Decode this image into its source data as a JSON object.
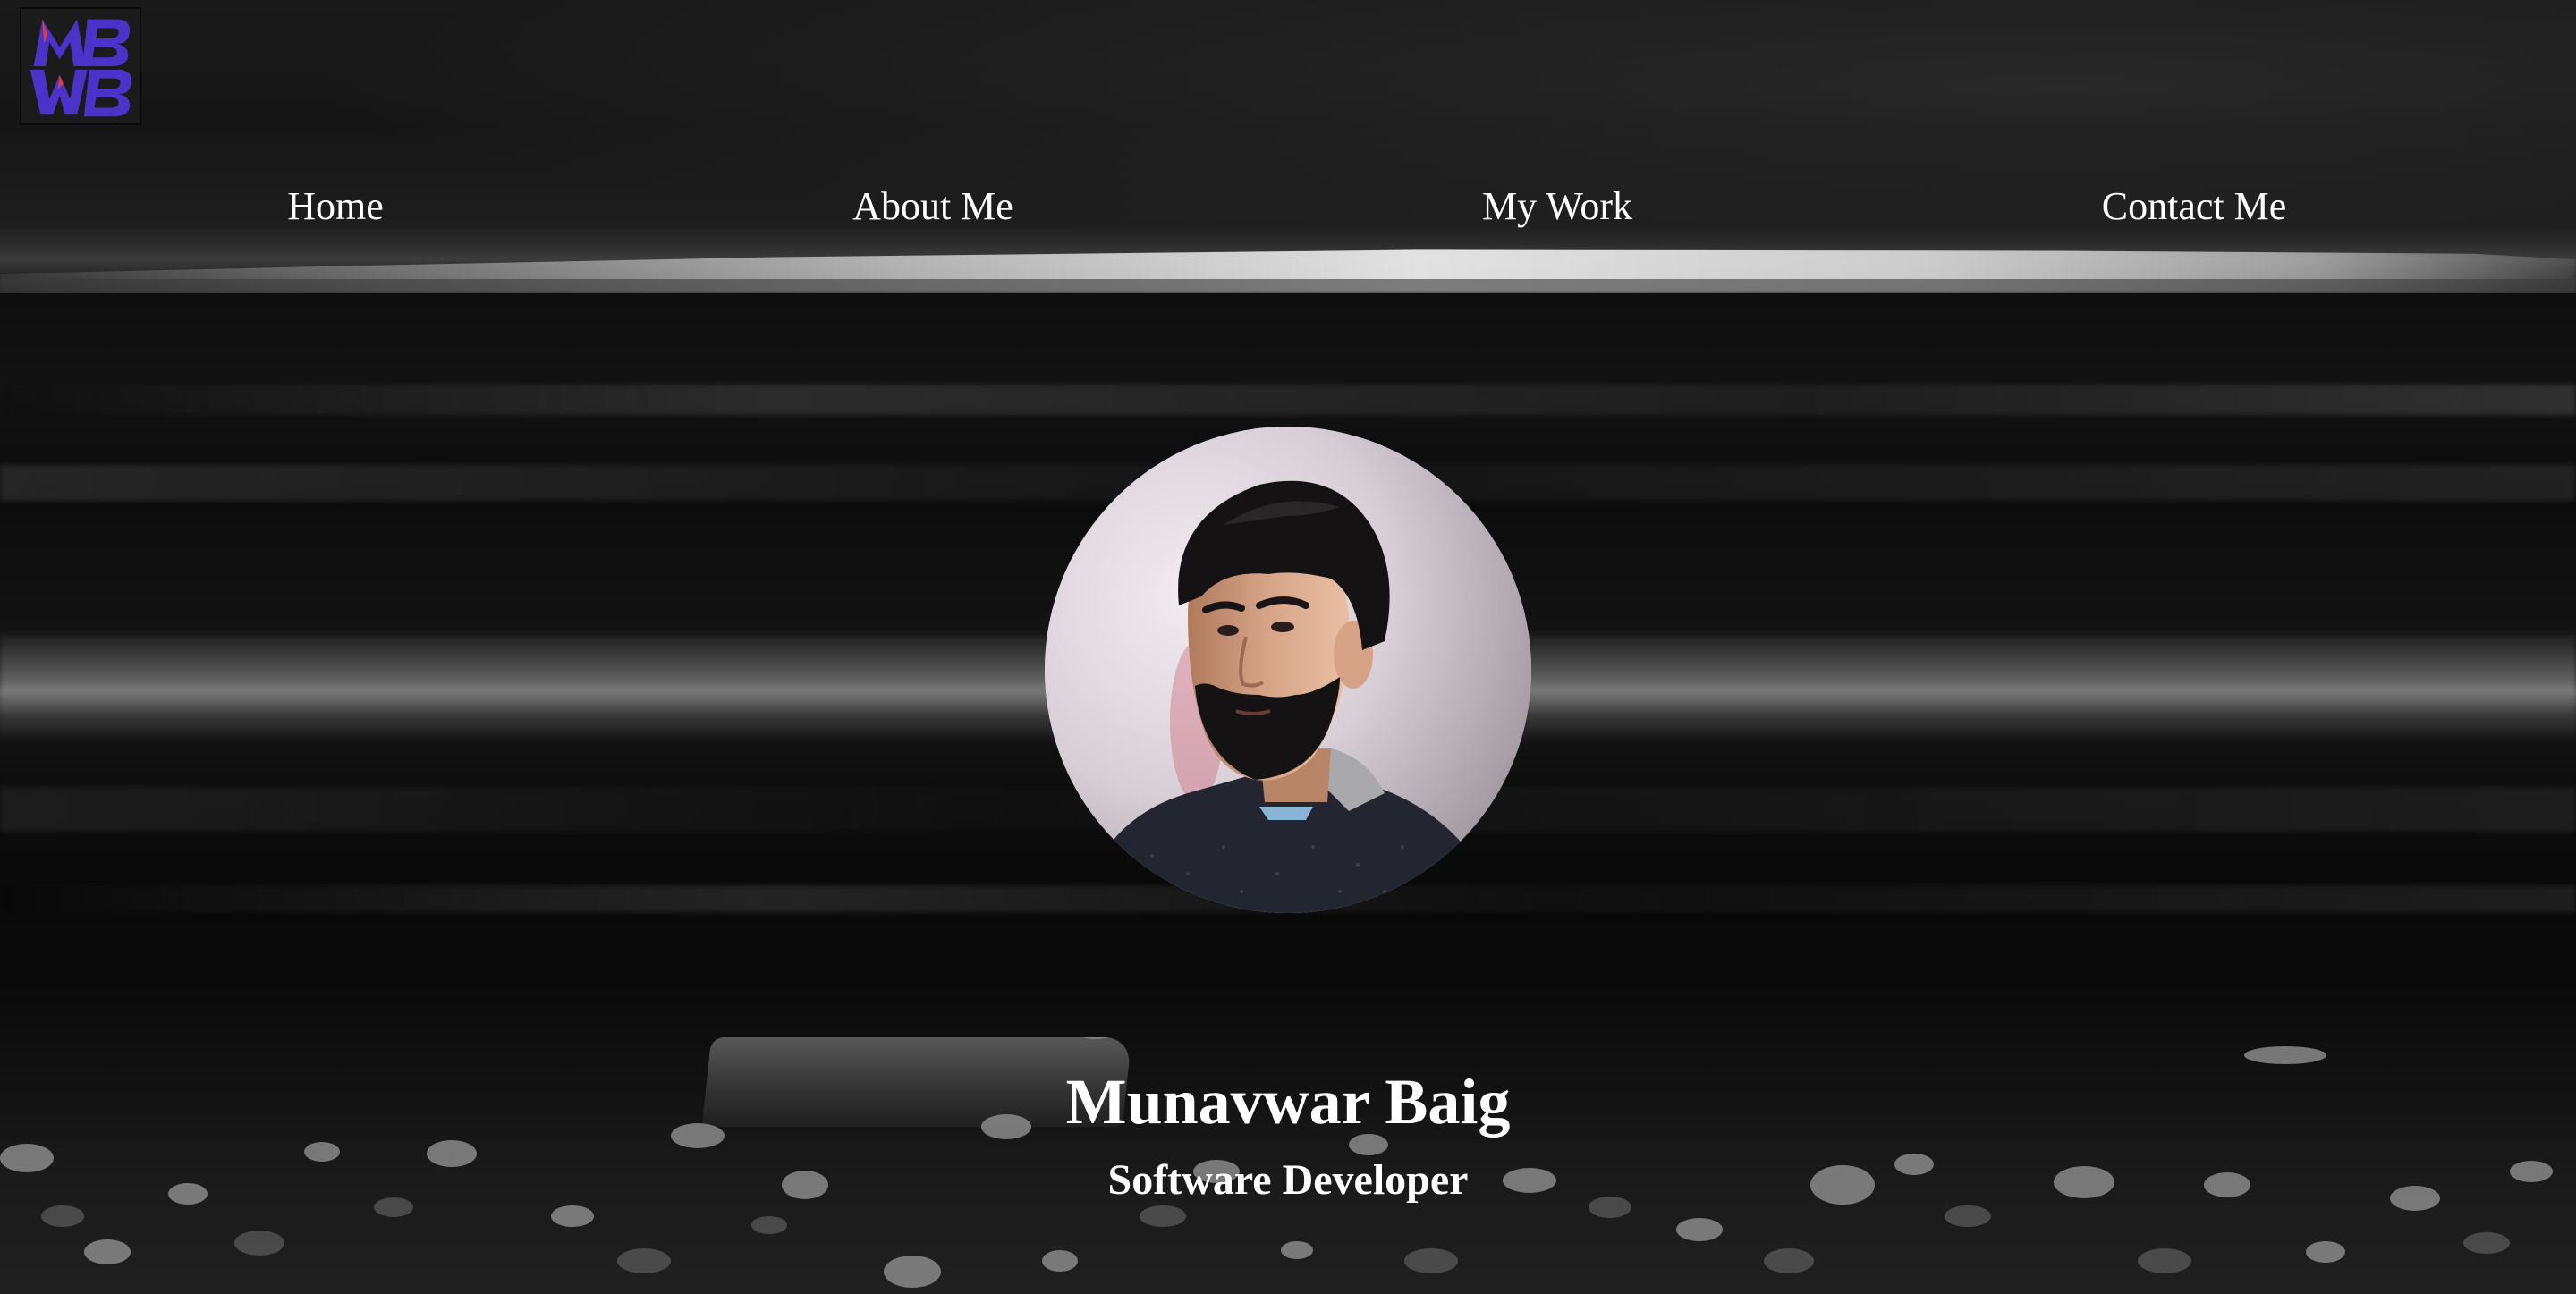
{
  "logo": {
    "text": "MBWB",
    "icon": "mb-monogram-logo",
    "colors": {
      "primary": "#4b33c9",
      "accent": "#e23c3c"
    }
  },
  "nav": {
    "items": [
      {
        "label": "Home"
      },
      {
        "label": "About Me"
      },
      {
        "label": "My Work"
      },
      {
        "label": "Contact Me"
      }
    ]
  },
  "hero": {
    "name": "Munavwar Baig",
    "title": "Software Developer",
    "avatar_icon": "profile-photo"
  },
  "colors": {
    "text": "#ffffff",
    "background": "#0b0b0b"
  }
}
